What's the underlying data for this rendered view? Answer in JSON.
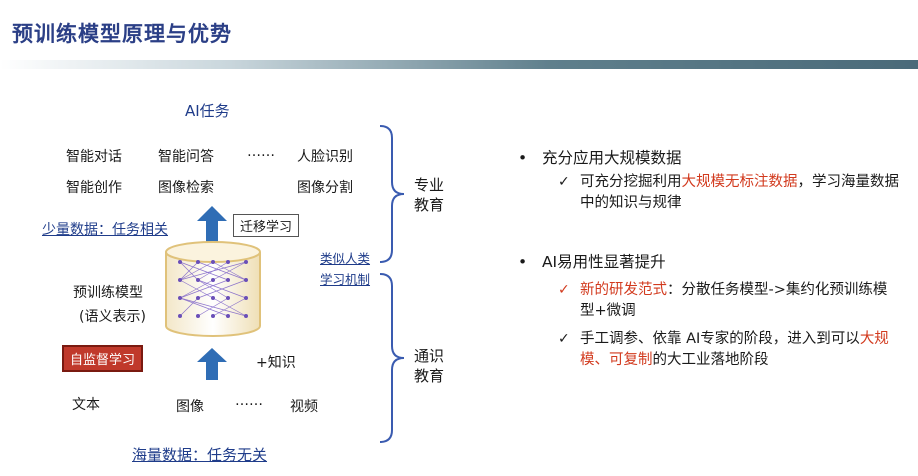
{
  "slide": {
    "title": "预训练模型原理与优势"
  },
  "diagram": {
    "ai_tasks": "AI任务",
    "tasks_row1": [
      "智能对话",
      "智能问答",
      "……",
      "人脸识别"
    ],
    "tasks_row2": [
      "智能创作",
      "图像检索",
      "图像分割"
    ],
    "few_data": "少量数据：任务相关",
    "transfer": "迁移学习",
    "pretrained_model": "预训练模型",
    "semantic_repr": "(语义表示)",
    "self_supervised": "自监督学习",
    "knowledge": "+知识",
    "inputs": [
      "文本",
      "图像",
      "……",
      "视频"
    ],
    "massive_data": "海量数据：任务无关",
    "professional_edu": "专业\n教育",
    "general_edu": "通识\n教育",
    "human_like": "类似人类",
    "learning_mech": "学习机制"
  },
  "bullets": [
    {
      "text": "充分应用大规模数据",
      "subs": [
        {
          "parts": [
            "可充分挖掘利用",
            "大规模无标注数据",
            "，学习海量数据中的知识与规律"
          ],
          "check_color": "#1a1a1a"
        }
      ]
    },
    {
      "text": "AI易用性显著提升",
      "subs": [
        {
          "parts": [
            "新的研发范式",
            "：分散任务模型->集约化预训练模型+微调"
          ],
          "check_color": "#d23a1e"
        },
        {
          "parts": [
            "手工调参、依靠 AI专家的阶段，进入到可以",
            "大规模、可复制",
            "的大工业落地阶段"
          ],
          "check_color": "#1a1a1a"
        }
      ]
    }
  ],
  "colors": {
    "title": "#2b3f86",
    "accent_red": "#d23a1e",
    "arrow_blue": "#2f6db5",
    "self_sup_box": "#c0392b"
  }
}
